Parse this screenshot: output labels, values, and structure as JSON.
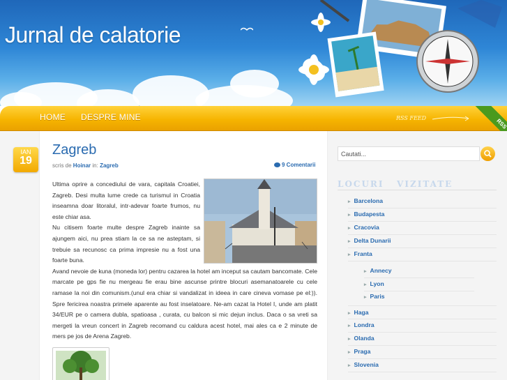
{
  "site": {
    "title": "Jurnal de calatorie"
  },
  "nav": {
    "items": [
      "HOME",
      "DESPRE MINE"
    ],
    "rss_feed": "RSS FEED",
    "rss_ribbon": "RSS"
  },
  "post": {
    "date_month": "IAN",
    "date_day": "19",
    "title": "Zagreb",
    "meta_prefix": "scris de",
    "author": "Hoinar",
    "meta_in": "in:",
    "category": "Zagreb",
    "comments": "9 Comentarii",
    "paragraphs": [
      "Ultima oprire a concediului de vara, capitala Croatiei, Zagreb. Desi multa lume crede ca turismul in Croatia inseamna doar litoralul, intr-adevar foarte frumos, nu este chiar asa.",
      "Nu citisem foarte multe despre Zagreb inainte sa ajungem aici, nu prea stiam la ce sa ne asteptam, si trebuie sa recunosc ca prima impresie nu a fost una foarte buna.",
      "Avand nevoie de kuna (moneda lor) pentru cazarea la hotel am inceput sa cautam bancomate. Cele marcate pe gps fie nu mergeau fie erau bine ascunse printre blocuri asemanatoarele cu cele ramase la noi din comunism.(unul era chiar si vandalizat in ideea in care cineva vomase pe el:)). Spre fericirea noastra primele aparente au fost inselatoare. Ne-am cazat la Hotel I, unde am platit 34/EUR pe o camera dubla, spatioasa , curata, cu balcon si mic dejun inclus. Daca o sa vreti sa mergeti la vreun concert in Zagreb recomand cu caldura acest hotel, mai ales ca e 2 minute de mers pe jos de Arena Zagreb."
    ]
  },
  "sidebar": {
    "search_placeholder": "Cautati...",
    "widget_title": "LOCURI   VIZITATE",
    "locations": [
      "Barcelona",
      "Budapesta",
      "Cracovia",
      "Delta Dunarii",
      "Franta"
    ],
    "franta_children": [
      "Annecy",
      "Lyon",
      "Paris"
    ],
    "locations_after": [
      "Haga",
      "Londra",
      "Olanda",
      "Praga",
      "Slovenia"
    ]
  },
  "colors": {
    "accent_yellow": "#f6b400",
    "link_blue": "#2a6bb0",
    "sky_blue": "#2e86d6"
  }
}
